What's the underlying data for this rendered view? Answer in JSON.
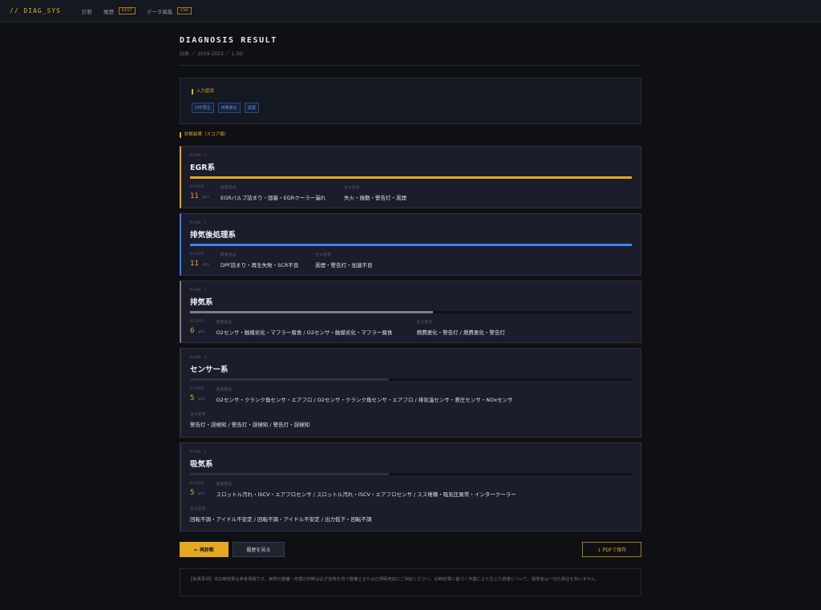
{
  "nav": {
    "logo": "// DIAG_SYS",
    "items": [
      {
        "label": "診断",
        "badge": null
      },
      {
        "label": "履歴",
        "badge": "HIST"
      },
      {
        "label": "データ編集",
        "badge": "CSV"
      }
    ]
  },
  "header": {
    "title": "DIAGNOSIS RESULT",
    "subtitle": "DJ系 ／ 2019-2022 ／ 1.5D"
  },
  "input_symptoms": {
    "label": "入力症状",
    "chips": [
      "DPF再生",
      "燃費悪化",
      "黒煙"
    ]
  },
  "results": {
    "label": "診断結果（スコア順）",
    "score_label": "SCORE",
    "score_unit": "pts",
    "parts_label": "関連部品",
    "symptoms_label": "主な症状",
    "cards": [
      {
        "rank": "RANK 1",
        "title": "EGR系",
        "score": "11",
        "bar_ratio": 1.0,
        "accent": "#e6a822",
        "parts": "EGRバルブ詰まり・固着・EGRクーラー漏れ",
        "symptoms": "失火・振動・警告灯・黒煙"
      },
      {
        "rank": "RANK 2",
        "title": "排気後処理系",
        "score": "11",
        "bar_ratio": 1.0,
        "accent": "#3d82f0",
        "parts": "DPF詰まり・再生失敗・SCR不良",
        "symptoms": "黒煙・警告灯・加速不良"
      },
      {
        "rank": "RANK 3",
        "title": "排気系",
        "score": "6",
        "bar_ratio": 0.55,
        "accent": "#7a7d86",
        "parts": "O2センサ・触媒劣化・マフラー腐食 / O2センサ・触媒劣化・マフラー腐食",
        "symptoms": "燃費悪化・警告灯 / 燃費悪化・警告灯"
      },
      {
        "rank": "RANK 4",
        "title": "センサー系",
        "score": "5",
        "bar_ratio": 0.45,
        "accent": "#2f333e",
        "parts": "O2センサ・クランク角センサ・エアフロ / O2センサ・クランク角センサ・エアフロ / 排気温センサ・差圧センサ・NOxセンサ",
        "symptoms": "警告灯・誤検知 / 警告灯・誤検知 / 警告灯・誤検知"
      },
      {
        "rank": "RANK 5",
        "title": "吸気系",
        "score": "5",
        "bar_ratio": 0.45,
        "accent": "#2f333e",
        "parts": "スロットル汚れ・ISCV・エアフロセンサ / スロットル汚れ・ISCV・エアフロセンサ / スス堆積・吸気圧異常・インタークーラー",
        "symptoms": "回転不調・アイドル不安定 / 回転不調・アイドル不安定 / 出力低下・回転不調"
      }
    ]
  },
  "actions": {
    "rediagnose": "← 再診断",
    "history": "履歴を見る",
    "pdf": "↓ PDFで保存"
  },
  "disclaimer": "【免責事項】本診断結果は参考情報です。実際の整備・修理の判断は必ず資格を持つ整備士または正規販売店にご相談ください。診断結果に基づく作業により生じた損害について、開発者は一切の責任を負いません。"
}
